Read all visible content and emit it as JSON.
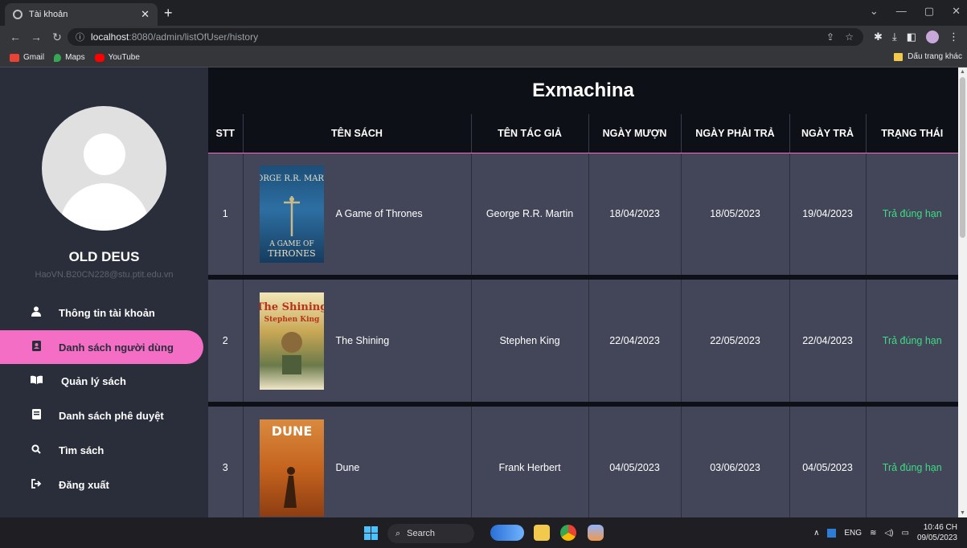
{
  "browser": {
    "tab_title": "Tài khoản",
    "url_host": "localhost",
    "url_path": ":8080/admin/listOfUser/history",
    "bookmarks": [
      {
        "label": "Gmail",
        "color": "#ea4335"
      },
      {
        "label": "Maps",
        "color": "#34a853"
      },
      {
        "label": "YouTube",
        "color": "#ff0000"
      }
    ],
    "other_bookmarks": "Dấu trang khác"
  },
  "sidebar": {
    "user_name": "OLD DEUS",
    "user_email": "HaoVN.B20CN228@stu.ptit.edu.vn",
    "items": [
      {
        "label": "Thông tin tài khoản",
        "icon": "user-icon"
      },
      {
        "label": "Danh sách người dùng",
        "icon": "address-book-icon",
        "active": true
      },
      {
        "label": "Quản lý sách",
        "icon": "open-book-icon"
      },
      {
        "label": "Danh sách phê duyệt",
        "icon": "book-icon"
      },
      {
        "label": "Tìm sách",
        "icon": "search-icon"
      },
      {
        "label": "Đăng xuất",
        "icon": "sign-out-icon"
      }
    ]
  },
  "main": {
    "title": "Exmachina",
    "columns": [
      "STT",
      "TÊN SÁCH",
      "TÊN TÁC GIẢ",
      "NGÀY MƯỢN",
      "NGÀY PHẢI TRẢ",
      "NGÀY TRẢ",
      "TRẠNG THÁI"
    ],
    "rows": [
      {
        "stt": "1",
        "book": "A Game of Thrones",
        "author": "George R.R. Martin",
        "borrowed": "18/04/2023",
        "due": "18/05/2023",
        "returned": "19/04/2023",
        "status": "Trả đúng hạn"
      },
      {
        "stt": "2",
        "book": "The Shining",
        "author": "Stephen King",
        "borrowed": "22/04/2023",
        "due": "22/05/2023",
        "returned": "22/04/2023",
        "status": "Trả đúng hạn"
      },
      {
        "stt": "3",
        "book": "Dune",
        "author": "Frank Herbert",
        "borrowed": "04/05/2023",
        "due": "03/06/2023",
        "returned": "04/05/2023",
        "status": "Trả đúng hạn"
      }
    ],
    "status_color": "#3ddc84",
    "accent_color": "#f36ec4"
  },
  "covers": {
    "got": {
      "author": "GEORGE R.R. MARTIN",
      "title_a": "A GAME OF",
      "title_b": "THRONES"
    },
    "shining": {
      "title": "The Shining",
      "author": "Stephen King"
    },
    "dune": {
      "title": "DUNE"
    }
  },
  "taskbar": {
    "search_label": "Search",
    "lang": "ENG",
    "time": "10:46 CH",
    "date": "09/05/2023"
  }
}
